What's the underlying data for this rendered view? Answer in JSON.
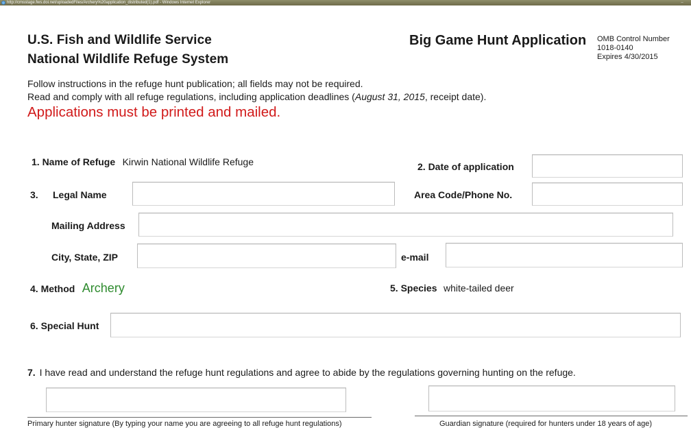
{
  "window": {
    "title": "http://cmsstage.fws.doi.net/uploadedFiles/Archery%20application_distributed(1).pdf - Windows Internet Explorer",
    "minimize_glyph": "–"
  },
  "header": {
    "agency": "U.S. Fish and Wildlife Service",
    "system": "National Wildlife Refuge System",
    "form_title": "Big Game Hunt Application",
    "omb_line1": "OMB Control Number",
    "omb_line2": "1018-0140",
    "omb_line3": "Expires 4/30/2015"
  },
  "instructions": {
    "line1": "Follow instructions in the refuge hunt publication;  all fields may not be required.",
    "line2_pre": "Read and comply with all refuge regulations, including application deadlines (",
    "line2_date": "August 31, 2015",
    "line2_post": ", receipt date).",
    "print_notice": "Applications must be printed and mailed."
  },
  "form": {
    "refuge_label": "1. Name of Refuge",
    "refuge_value": "Kirwin National Wildlife Refuge",
    "date_label": "2. Date of application",
    "date_value": "",
    "legal_number": "3.",
    "legal_label": "Legal Name",
    "legal_value": "",
    "phone_label": "Area Code/Phone No.",
    "phone_value": "",
    "address_label": "Mailing Address",
    "address_value": "",
    "city_label": "City, State, ZIP",
    "city_value": "",
    "email_label": "e-mail",
    "email_value": "",
    "method_label": "4. Method",
    "method_value": "Archery",
    "species_label": "5. Species",
    "species_value": "white-tailed deer",
    "special_label": "6. Special Hunt",
    "special_value": "",
    "agreement_number": "7.",
    "agreement_text": "I have read and understand the refuge hunt regulations  and agree to abide by the regulations governing hunting on the refuge.",
    "primary_sig_value": "",
    "guardian_sig_value": "",
    "primary_caption": "Primary hunter signature (By typing your name you are agreeing to all refuge hunt regulations)",
    "guardian_caption": "Guardian signature (required for hunters  under  18 years of age)"
  },
  "colors": {
    "notice_red": "#d11a1a",
    "method_green": "#2e8b2e",
    "titlebar": "#7d7b58"
  }
}
